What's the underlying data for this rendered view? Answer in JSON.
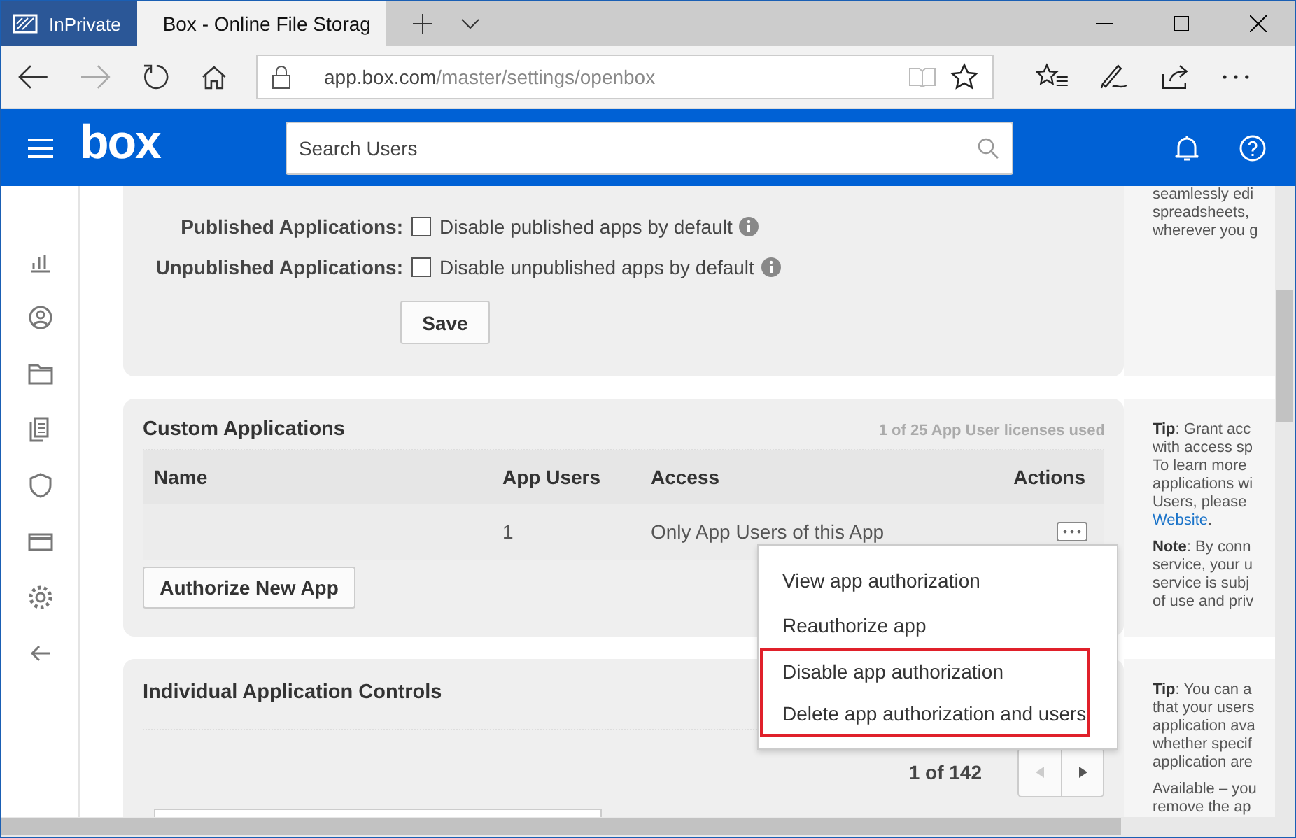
{
  "browser": {
    "private_label": "InPrivate",
    "tab_title": "Box - Online File Storag",
    "url_host": "app.box.com",
    "url_path": "/master/settings/openbox"
  },
  "header": {
    "logo": "box",
    "search": {
      "placeholder": "Search Users"
    }
  },
  "sidebar": {
    "items": [
      {
        "kind": "chart"
      },
      {
        "kind": "user"
      },
      {
        "kind": "folder"
      },
      {
        "kind": "docs"
      },
      {
        "kind": "shield"
      },
      {
        "kind": "card"
      },
      {
        "kind": "gear"
      },
      {
        "kind": "back"
      }
    ]
  },
  "defaults": {
    "rows": [
      {
        "label": "Published Applications:",
        "option": "Disable published apps by default",
        "checked": false
      },
      {
        "label": "Unpublished Applications:",
        "option": "Disable unpublished apps by default",
        "checked": false
      }
    ],
    "save": "Save",
    "tip_lines": [
      "seamlessly edi",
      "spreadsheets,",
      "wherever you g"
    ]
  },
  "custom": {
    "title": "Custom Applications",
    "licenses": "1 of 25 App User licenses used",
    "columns": [
      "Name",
      "App Users",
      "Access",
      "Actions"
    ],
    "rows": [
      {
        "app_users": "1",
        "access": "Only App Users of this App"
      }
    ],
    "authorize": "Authorize New App",
    "tip_lines": [
      "**Tip**: Grant acc",
      "with access sp",
      "To learn more",
      "applications wi",
      "Users, please"
    ],
    "tip_link": "Website",
    "tip_link_end": ".",
    "note_lines": [
      "**Note**: By conn",
      "service, your u",
      "service is subj",
      "of use and priv"
    ]
  },
  "individual": {
    "title": "Individual Application Controls",
    "pager": "1 of 142",
    "tip_lines": [
      "**Tip**: You can a",
      "that your users",
      "application ava",
      "whether specif",
      "application are"
    ],
    "tip2_lines": [
      "Available – you",
      "remove the ap"
    ]
  },
  "menu": {
    "items": [
      {
        "label": "View app authorization",
        "highlighted": false
      },
      {
        "label": "Reauthorize app",
        "highlighted": false
      },
      {
        "label": "Disable app authorization",
        "highlighted": true
      },
      {
        "label": "Delete app authorization and users",
        "highlighted": true
      }
    ]
  }
}
